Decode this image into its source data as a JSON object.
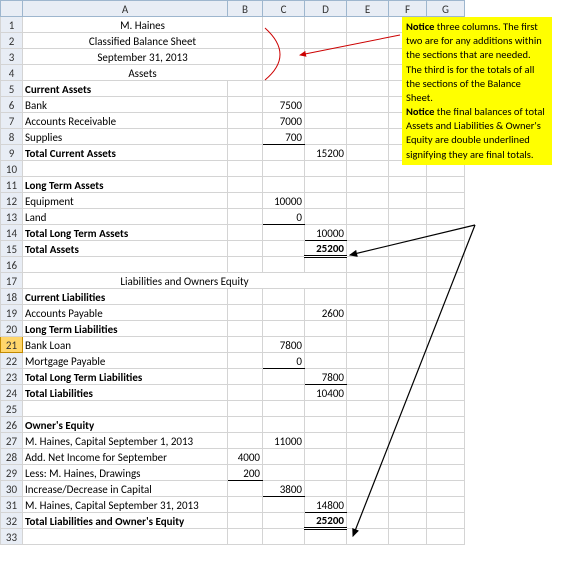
{
  "cols": [
    "",
    "A",
    "B",
    "C",
    "D",
    "E",
    "F",
    "G"
  ],
  "header": {
    "r1": "M. Haines",
    "r2": "Classified Balance Sheet",
    "r3": "September 31, 2013",
    "r4": "Assets"
  },
  "ca": {
    "title": "Current Assets",
    "bank": "Bank",
    "bank_v": "7500",
    "ar": "Accounts Receivable",
    "ar_v": "7000",
    "supp": "Supplies",
    "supp_v": "700",
    "total": "Total Current Assets",
    "total_v": "15200"
  },
  "lta": {
    "title": "Long Term Assets",
    "equip": "Equipment",
    "equip_v": "10000",
    "land": "Land",
    "land_v": "0",
    "total": "Total Long Term Assets",
    "total_v": "10000"
  },
  "ta": {
    "label": "Total Assets",
    "v": "25200"
  },
  "section2": "Liabilities and Owners Equity",
  "cl": {
    "title": "Current Liabilities",
    "ap": "Accounts Payable",
    "ap_v": "2600"
  },
  "ltl": {
    "title": "Long Term Liabilities",
    "loan": "Bank Loan",
    "loan_v": "7800",
    "mort": "Mortgage Payable",
    "mort_v": "0",
    "total": "Total Long Term Liabilities",
    "total_v": "7800"
  },
  "tl": {
    "label": "Total Liabilities",
    "v": "10400"
  },
  "oe": {
    "title": "Owner's Equity",
    "cap1": "M. Haines, Capital September 1, 2013",
    "cap1_v": "11000",
    "ni": "Add. Net Income for September",
    "ni_v": "4000",
    "draw": "Less: M. Haines, Drawings",
    "draw_v": "200",
    "chg": "Increase/Decrease in Capital",
    "chg_v": "3800",
    "cap2": "M. Haines, Capital September 31, 2013",
    "cap2_v": "14800"
  },
  "tloe": {
    "label": "Total Liabilities and Owner's Equity",
    "v": "25200"
  },
  "note": {
    "n1": "Notice",
    "t1": " three columns. The first  two are for any additions within the sections that are needed. The third is for the totals of all the sections of the Balance Sheet.",
    "n2": "Notice",
    "t2": " the final balances of total Assets and Liabilities & Owner's Equity are double underlined signifying they are final totals."
  }
}
